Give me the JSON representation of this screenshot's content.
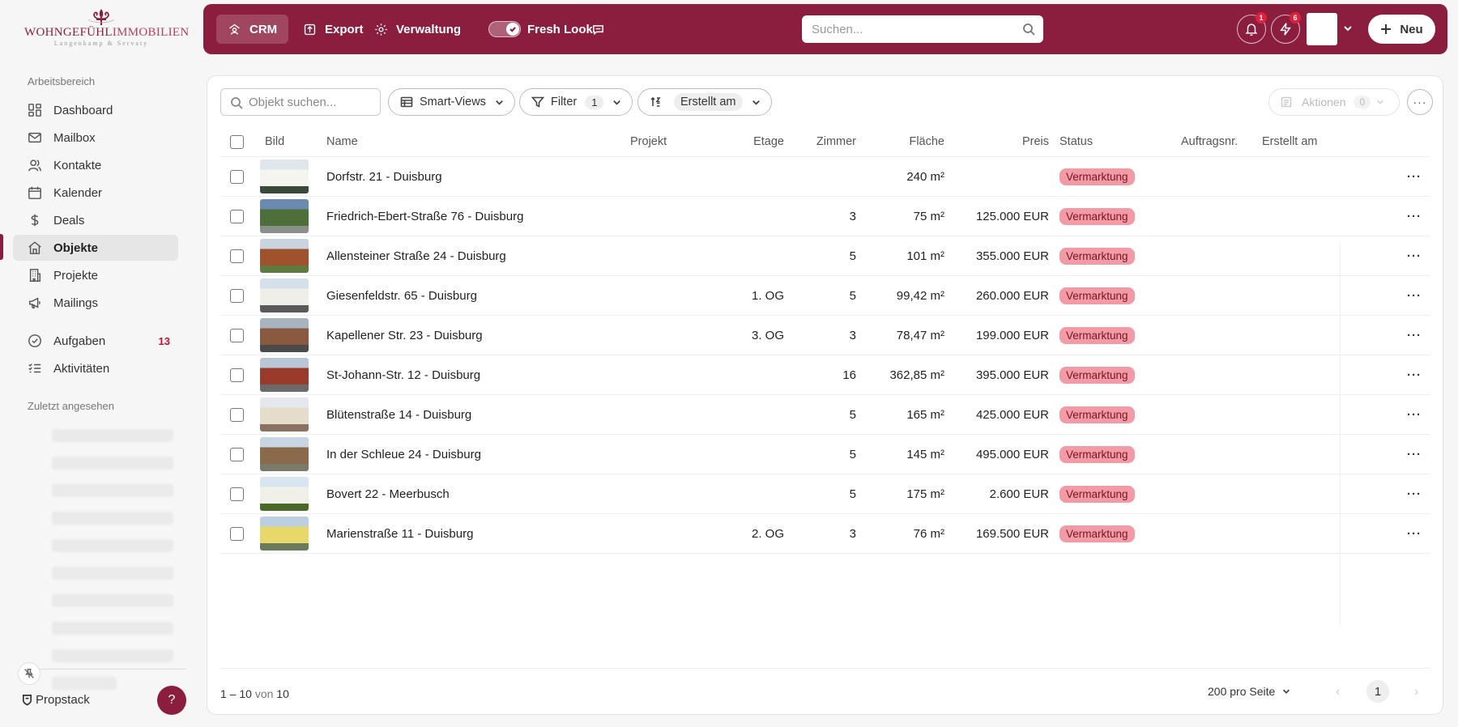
{
  "brand": {
    "logo_main": "WOHNGEFÜHL",
    "logo_light": "IMMOBILIEN",
    "logo_sub": "Langenkamp & Servaty",
    "accent_color": "#8b1e3f"
  },
  "sidebar": {
    "section_workspace": "Arbeitsbereich",
    "items": [
      {
        "label": "Dashboard",
        "icon": "dashboard-icon"
      },
      {
        "label": "Mailbox",
        "icon": "mail-icon"
      },
      {
        "label": "Kontakte",
        "icon": "contacts-icon"
      },
      {
        "label": "Kalender",
        "icon": "calendar-icon"
      },
      {
        "label": "Deals",
        "icon": "dollar-icon"
      },
      {
        "label": "Objekte",
        "icon": "home-icon",
        "active": true
      },
      {
        "label": "Projekte",
        "icon": "building-icon"
      },
      {
        "label": "Mailings",
        "icon": "megaphone-icon"
      }
    ],
    "tasks": {
      "label": "Aufgaben",
      "badge": "13",
      "icon": "check-circle-icon"
    },
    "activities": {
      "label": "Aktivitäten",
      "icon": "checklist-icon"
    },
    "section_recent": "Zuletzt angesehen",
    "footer_brand": "Propstack",
    "help_label": "?"
  },
  "topbar": {
    "crm": "CRM",
    "export": "Export",
    "admin": "Verwaltung",
    "fresh_look": "Fresh Look",
    "fresh_look_on": true,
    "search_placeholder": "Suchen...",
    "notifications_count": "1",
    "activity_count": "6",
    "new_label": "Neu"
  },
  "toolbar": {
    "object_search_placeholder": "Objekt suchen...",
    "smart_views": "Smart-Views",
    "filter": "Filter",
    "filter_count": "1",
    "sort_value": "Erstellt am",
    "actions": "Aktionen",
    "actions_count": "0",
    "more": "···"
  },
  "table": {
    "columns": {
      "image": "Bild",
      "name": "Name",
      "project": "Projekt",
      "floor": "Etage",
      "rooms": "Zimmer",
      "area": "Fläche",
      "price": "Preis",
      "status": "Status",
      "order_no": "Auftragsnr.",
      "created": "Erstellt am"
    },
    "rows": [
      {
        "name": "Dorfstr. 21 - Duisburg",
        "floor": "",
        "rooms": "",
        "area": "240 m²",
        "price": "",
        "status": "Vermarktung",
        "thumb": [
          "#dfe6ec",
          "#f5f5f0",
          "#3a4a3a"
        ]
      },
      {
        "name": "Friedrich-Ebert-Straße 76 - Duisburg",
        "floor": "",
        "rooms": "3",
        "area": "75 m²",
        "price": "125.000 EUR",
        "status": "Vermarktung",
        "thumb": [
          "#6a8ab0",
          "#4f6f3a",
          "#8a8f8a"
        ]
      },
      {
        "name": "Allensteiner Straße 24 - Duisburg",
        "floor": "",
        "rooms": "5",
        "area": "101 m²",
        "price": "355.000 EUR",
        "status": "Vermarktung",
        "thumb": [
          "#c9d4de",
          "#a0522d",
          "#5f7a3f"
        ]
      },
      {
        "name": "Giesenfeldstr. 65 - Duisburg",
        "floor": "1. OG",
        "rooms": "5",
        "area": "99,42 m²",
        "price": "260.000 EUR",
        "status": "Vermarktung",
        "thumb": [
          "#d5e0ea",
          "#efefea",
          "#5a5a5a"
        ]
      },
      {
        "name": "Kapellener Str. 23 - Duisburg",
        "floor": "3. OG",
        "rooms": "3",
        "area": "78,47 m²",
        "price": "199.000 EUR",
        "status": "Vermarktung",
        "thumb": [
          "#a8b4c0",
          "#8a5a40",
          "#4a4a4a"
        ]
      },
      {
        "name": "St-Johann-Str. 12 - Duisburg",
        "floor": "",
        "rooms": "16",
        "area": "362,85 m²",
        "price": "395.000 EUR",
        "status": "Vermarktung",
        "thumb": [
          "#b8c6d6",
          "#9a3a2a",
          "#6a6a6a"
        ]
      },
      {
        "name": "Blütenstraße 14 - Duisburg",
        "floor": "",
        "rooms": "5",
        "area": "165 m²",
        "price": "425.000 EUR",
        "status": "Vermarktung",
        "thumb": [
          "#e4e8ee",
          "#e6dccb",
          "#8a7060"
        ]
      },
      {
        "name": "In der Schleue 24 - Duisburg",
        "floor": "",
        "rooms": "5",
        "area": "145 m²",
        "price": "495.000 EUR",
        "status": "Vermarktung",
        "thumb": [
          "#c8d6e4",
          "#8a6a4a",
          "#7a7a6a"
        ]
      },
      {
        "name": "Bovert 22 - Meerbusch",
        "floor": "",
        "rooms": "5",
        "area": "175 m²",
        "price": "2.600 EUR",
        "status": "Vermarktung",
        "thumb": [
          "#d8e6f2",
          "#f0efe8",
          "#4a6a2a"
        ]
      },
      {
        "name": "Marienstraße 11 - Duisburg",
        "floor": "2. OG",
        "rooms": "3",
        "area": "76 m²",
        "price": "169.500 EUR",
        "status": "Vermarktung",
        "thumb": [
          "#bcd0e2",
          "#e8d86a",
          "#6a7a5a"
        ]
      }
    ]
  },
  "footer": {
    "range": "1 – 10",
    "of": "von",
    "total": "10",
    "per_page": "200 pro Seite",
    "page": "1",
    "prev": "‹",
    "next": "›"
  }
}
